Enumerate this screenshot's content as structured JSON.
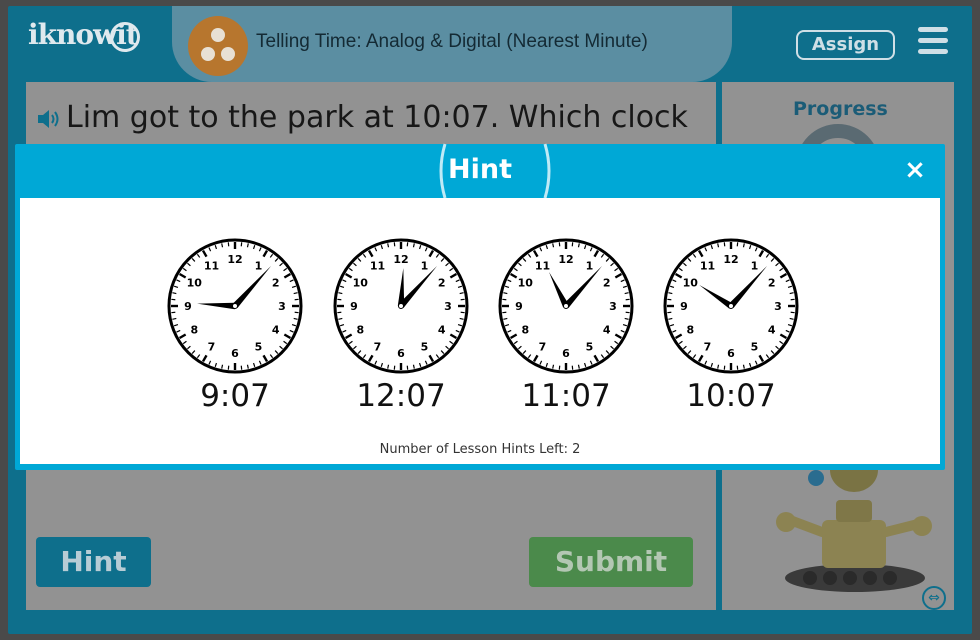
{
  "header": {
    "logo": "iknowit",
    "lesson_title": "Telling Time: Analog & Digital (Nearest Minute)",
    "assign_label": "Assign",
    "menu_icon": "hamburger-menu-icon"
  },
  "question": {
    "text": "Lim got to the park at 10:07. Which clock",
    "speaker_icon": "speaker-icon"
  },
  "sidebar": {
    "progress_label": "Progress"
  },
  "buttons": {
    "hint_label": "Hint",
    "submit_label": "Submit"
  },
  "hint_modal": {
    "title": "Hint",
    "close_label": "×",
    "clocks": [
      {
        "time": "9:07",
        "hour": 9,
        "minute": 7
      },
      {
        "time": "12:07",
        "hour": 12,
        "minute": 7
      },
      {
        "time": "11:07",
        "hour": 11,
        "minute": 7
      },
      {
        "time": "10:07",
        "hour": 10,
        "minute": 7
      }
    ],
    "hints_left_text": "Number of Lesson Hints Left: 2"
  },
  "colors": {
    "frame_teal": "#0e6f8c",
    "modal_blue": "#00a8d6",
    "submit_green": "#4b8a4b"
  }
}
